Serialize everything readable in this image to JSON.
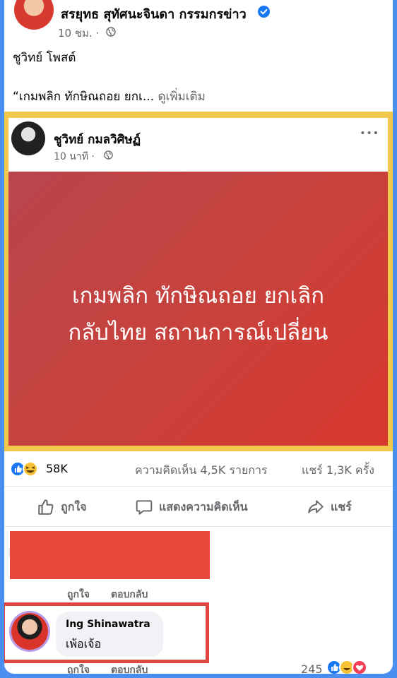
{
  "outer_post": {
    "author": "สรยุทธ สุทัศนะจินดา กรรมกรข่าว",
    "time": "10 ชม.",
    "dot": "·",
    "line1": "ชูวิทย์ โพสต์",
    "line2_prefix": "“เกมพลิก ทักษิณถอย ยกเ...",
    "line2_more": "ดูเพิ่มเติม"
  },
  "inner_post": {
    "author": "ชูวิทย์ กมลวิศิษฏ์",
    "time": "10 นาที",
    "dot": "·",
    "more": "•••",
    "image_lines": [
      "เกมพลิก ทักษิณถอย ยกเลิก",
      "กลับไทย สถานการณ์เปลี่ยน"
    ]
  },
  "stats": {
    "reactions": "58K",
    "comments": "ความคิดเห็น 4,5K รายการ",
    "shares": "แชร์ 1,3K ครั้ง"
  },
  "actions": {
    "like": "ถูกใจ",
    "comment": "แสดงความคิดเห็น",
    "share": "แชร์"
  },
  "comments": {
    "first_like": "ถูกใจ",
    "first_reply": "ตอบกลับ",
    "second_author": "Ing Shinawatra",
    "second_text": "เพ้อเจ้อ",
    "second_like": "ถูกใจ",
    "second_reply": "ตอบกลับ",
    "second_reaction_count": "245"
  },
  "colors": {
    "background_blue": "#4a8ef0",
    "highlight_yellow": "#f3c94d",
    "image_red": "#c94545",
    "redaction": "#e8473c",
    "annotation_red": "#e0463d",
    "verified_blue": "#1877f2"
  }
}
